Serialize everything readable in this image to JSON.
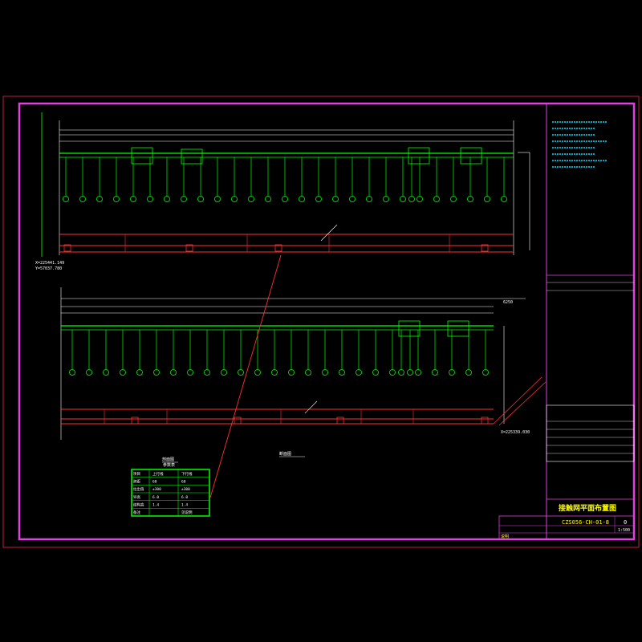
{
  "colors": {
    "background": "#000000",
    "outer_frame": "#c0203a",
    "inner_frame": "#e040e0",
    "structure": "#00ff00",
    "dimension": "#ffffff",
    "rail": "#ff3030",
    "leader": "#ff3030",
    "title_text": "#ffff00",
    "note_text": "#00e0ff",
    "table_frame": "#00ff00"
  },
  "upper_view": {
    "coord_label_1": "X=225441.149",
    "coord_label_2": "Y=57037.780"
  },
  "lower_view": {
    "dim_right": "6250",
    "coord_label": "X=225339.030"
  },
  "callouts": {
    "section_label_1": "剖面图",
    "section_label_2": "断面图"
  },
  "table_title": "参数表",
  "table_rows": [
    [
      "项目",
      "上行线",
      "下行线"
    ],
    [
      "跨距",
      "60",
      "60"
    ],
    [
      "拉出值",
      "±300",
      "±300"
    ],
    [
      "导高",
      "6.0",
      "6.0"
    ],
    [
      "结构高",
      "1.4",
      "1.4"
    ],
    [
      "备注",
      "",
      "见说明"
    ]
  ],
  "title_block": {
    "drawing_title": "接触网平面布置图",
    "drawing_number": "CZS056-CH-01-8",
    "revision": "0",
    "scale": "1:500",
    "note_line": "说明"
  }
}
